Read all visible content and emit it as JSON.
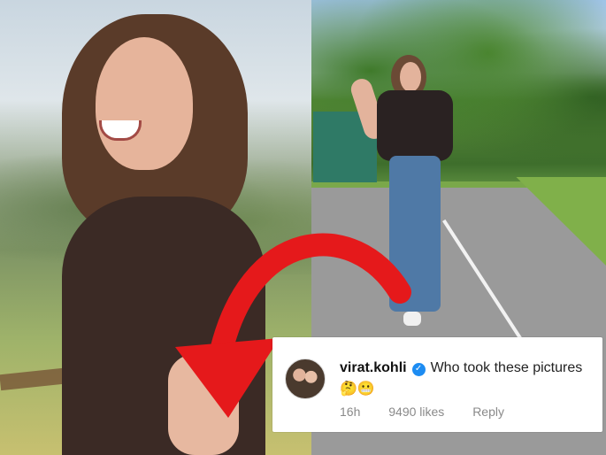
{
  "comment": {
    "username": "virat.kohli",
    "text": "Who took these pictures",
    "emoji_1": "🤔",
    "emoji_2": "😬",
    "time": "16h",
    "likes": "9490 likes",
    "reply_label": "Reply",
    "verified_icon": "✓"
  },
  "colors": {
    "accent_arrow": "#e5191b",
    "verified_blue": "#1d8cf2"
  }
}
